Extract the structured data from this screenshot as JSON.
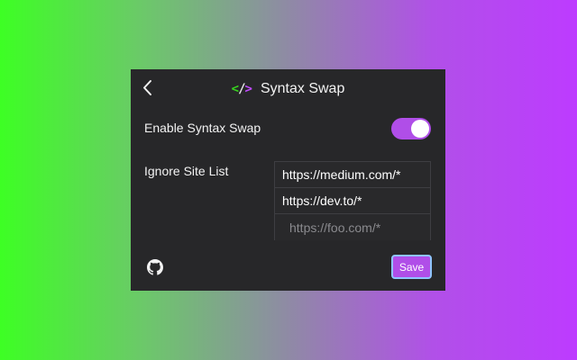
{
  "header": {
    "back_icon": "chevron-left-icon",
    "logo": {
      "lt": "<",
      "slash": "/",
      "gt": ">"
    },
    "title": "Syntax Swap"
  },
  "settings": {
    "enable_label": "Enable Syntax Swap",
    "enabled": true,
    "ignore_label": "Ignore Site List",
    "ignore_sites": [
      "https://medium.com/*",
      "https://dev.to/*"
    ],
    "new_site_placeholder": "https://foo.com/*",
    "new_site_value": ""
  },
  "footer": {
    "github_icon": "github-icon",
    "save_label": "Save"
  },
  "colors": {
    "accent": "#b04ee8",
    "panel_bg": "#272729",
    "logo_green": "#38d41f",
    "logo_purple": "#c24bff"
  }
}
